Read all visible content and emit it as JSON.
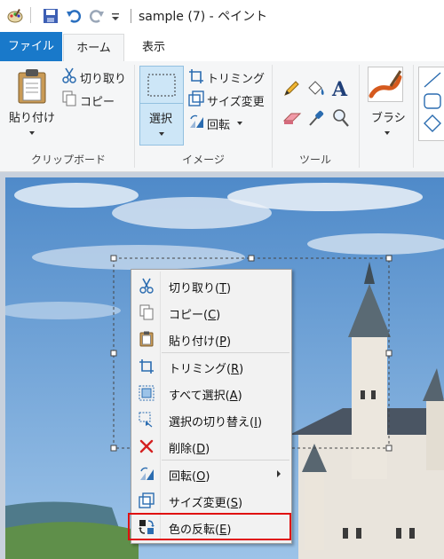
{
  "window": {
    "title": "sample (7) - ペイント"
  },
  "tabs": {
    "file": "ファイル",
    "home": "ホーム",
    "view": "表示"
  },
  "clipboard": {
    "paste": "貼り付け",
    "cut": "切り取り",
    "copy": "コピー",
    "group_label": "クリップボード"
  },
  "image": {
    "select": "選択",
    "crop": "トリミング",
    "resize": "サイズ変更",
    "rotate": "回転",
    "group_label": "イメージ"
  },
  "tools": {
    "group_label": "ツール"
  },
  "brushes": {
    "label": "ブラシ"
  },
  "context_menu": {
    "items": [
      {
        "label": "切り取り",
        "key": "T",
        "icon": "scissors-icon"
      },
      {
        "label": "コピー",
        "key": "C",
        "icon": "copy-icon"
      },
      {
        "label": "貼り付け",
        "key": "P",
        "icon": "paste-icon"
      },
      {
        "label": "トリミング",
        "key": "R",
        "icon": "crop-icon"
      },
      {
        "label": "すべて選択",
        "key": "A",
        "icon": "select-all-icon"
      },
      {
        "label": "選択の切り替え",
        "key": "I",
        "icon": "invert-selection-icon"
      },
      {
        "label": "削除",
        "key": "D",
        "icon": "delete-icon"
      },
      {
        "label": "回転",
        "key": "O",
        "icon": "rotate-icon"
      },
      {
        "label": "サイズ変更",
        "key": "S",
        "icon": "resize-icon"
      },
      {
        "label": "色の反転",
        "key": "E",
        "icon": "invert-color-icon"
      }
    ]
  },
  "colors": {
    "accent": "#1979ca",
    "ribbon_bg": "#f5f6f7",
    "selected_bg": "#cde6f7",
    "highlight": "#e01010"
  }
}
